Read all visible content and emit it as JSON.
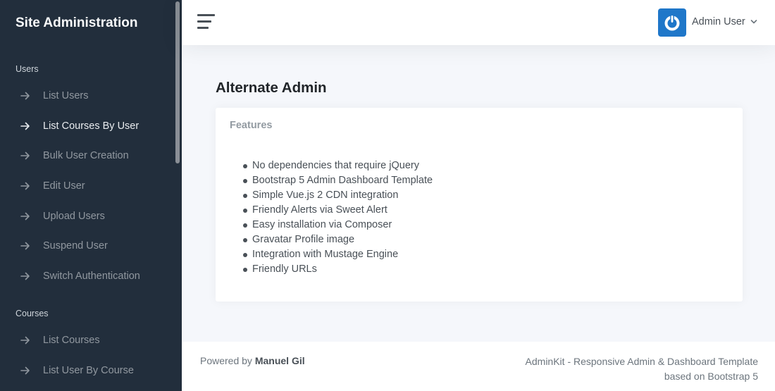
{
  "sidebar": {
    "brand": "Site Administration",
    "sections": [
      {
        "header": "Users",
        "items": [
          {
            "label": "List Users",
            "active": false
          },
          {
            "label": "List Courses By User",
            "active": true
          },
          {
            "label": "Bulk User Creation",
            "active": false
          },
          {
            "label": "Edit User",
            "active": false
          },
          {
            "label": "Upload Users",
            "active": false
          },
          {
            "label": "Suspend User",
            "active": false
          },
          {
            "label": "Switch Authentication",
            "active": false
          }
        ]
      },
      {
        "header": "Courses",
        "items": [
          {
            "label": "List Courses",
            "active": false
          },
          {
            "label": "List User By Course",
            "active": false
          }
        ]
      }
    ]
  },
  "topbar": {
    "user_name": "Admin User",
    "avatar_icon": "power-icon",
    "avatar_color": "#1f77c9"
  },
  "main": {
    "title": "Alternate Admin",
    "card": {
      "title": "Features",
      "features": [
        "No dependencies that require jQuery",
        "Bootstrap 5 Admin Dashboard Template",
        "Simple Vue.js 2 CDN integration",
        "Friendly Alerts via Sweet Alert",
        "Easy installation via Composer",
        "Gravatar Profile image",
        "Integration with Mustage Engine",
        "Friendly URLs"
      ]
    }
  },
  "footer": {
    "powered_by": "Powered by",
    "author": "Manuel Gil",
    "right_line1": "AdminKit - Responsive Admin & Dashboard Template",
    "right_line2": "based on Bootstrap 5"
  }
}
